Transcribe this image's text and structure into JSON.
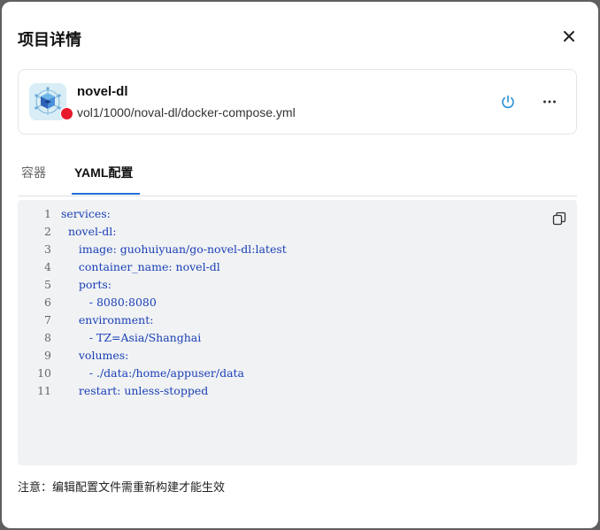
{
  "dialog": {
    "title": "项目详情",
    "close_icon": "close-icon"
  },
  "project": {
    "name": "novel-dl",
    "path": "vol1/1000/noval-dl/docker-compose.yml",
    "icon": "docker-compose-cube-icon",
    "status_color": "#e8192c",
    "power_icon": "power-icon",
    "power_color": "#2a8fd6",
    "more_icon": "more-horizontal-icon"
  },
  "tabs": [
    {
      "label": "容器",
      "active": false
    },
    {
      "label": "YAML配置",
      "active": true
    }
  ],
  "editor": {
    "copy_icon": "copy-icon",
    "lines": [
      {
        "no": "1",
        "text": "services:"
      },
      {
        "no": "2",
        "text": "  novel-dl:"
      },
      {
        "no": "3",
        "text": "     image: guohuiyuan/go-novel-dl:latest"
      },
      {
        "no": "4",
        "text": "     container_name: novel-dl"
      },
      {
        "no": "5",
        "text": "     ports:"
      },
      {
        "no": "6",
        "text": "        - 8080:8080"
      },
      {
        "no": "7",
        "text": "     environment:"
      },
      {
        "no": "8",
        "text": "        - TZ=Asia/Shanghai"
      },
      {
        "no": "9",
        "text": "     volumes:"
      },
      {
        "no": "10",
        "text": "        - ./data:/home/appuser/data"
      },
      {
        "no": "11",
        "text": "     restart: unless-stopped"
      }
    ]
  },
  "footer": {
    "note": "注意：编辑配置文件需重新构建才能生效"
  }
}
